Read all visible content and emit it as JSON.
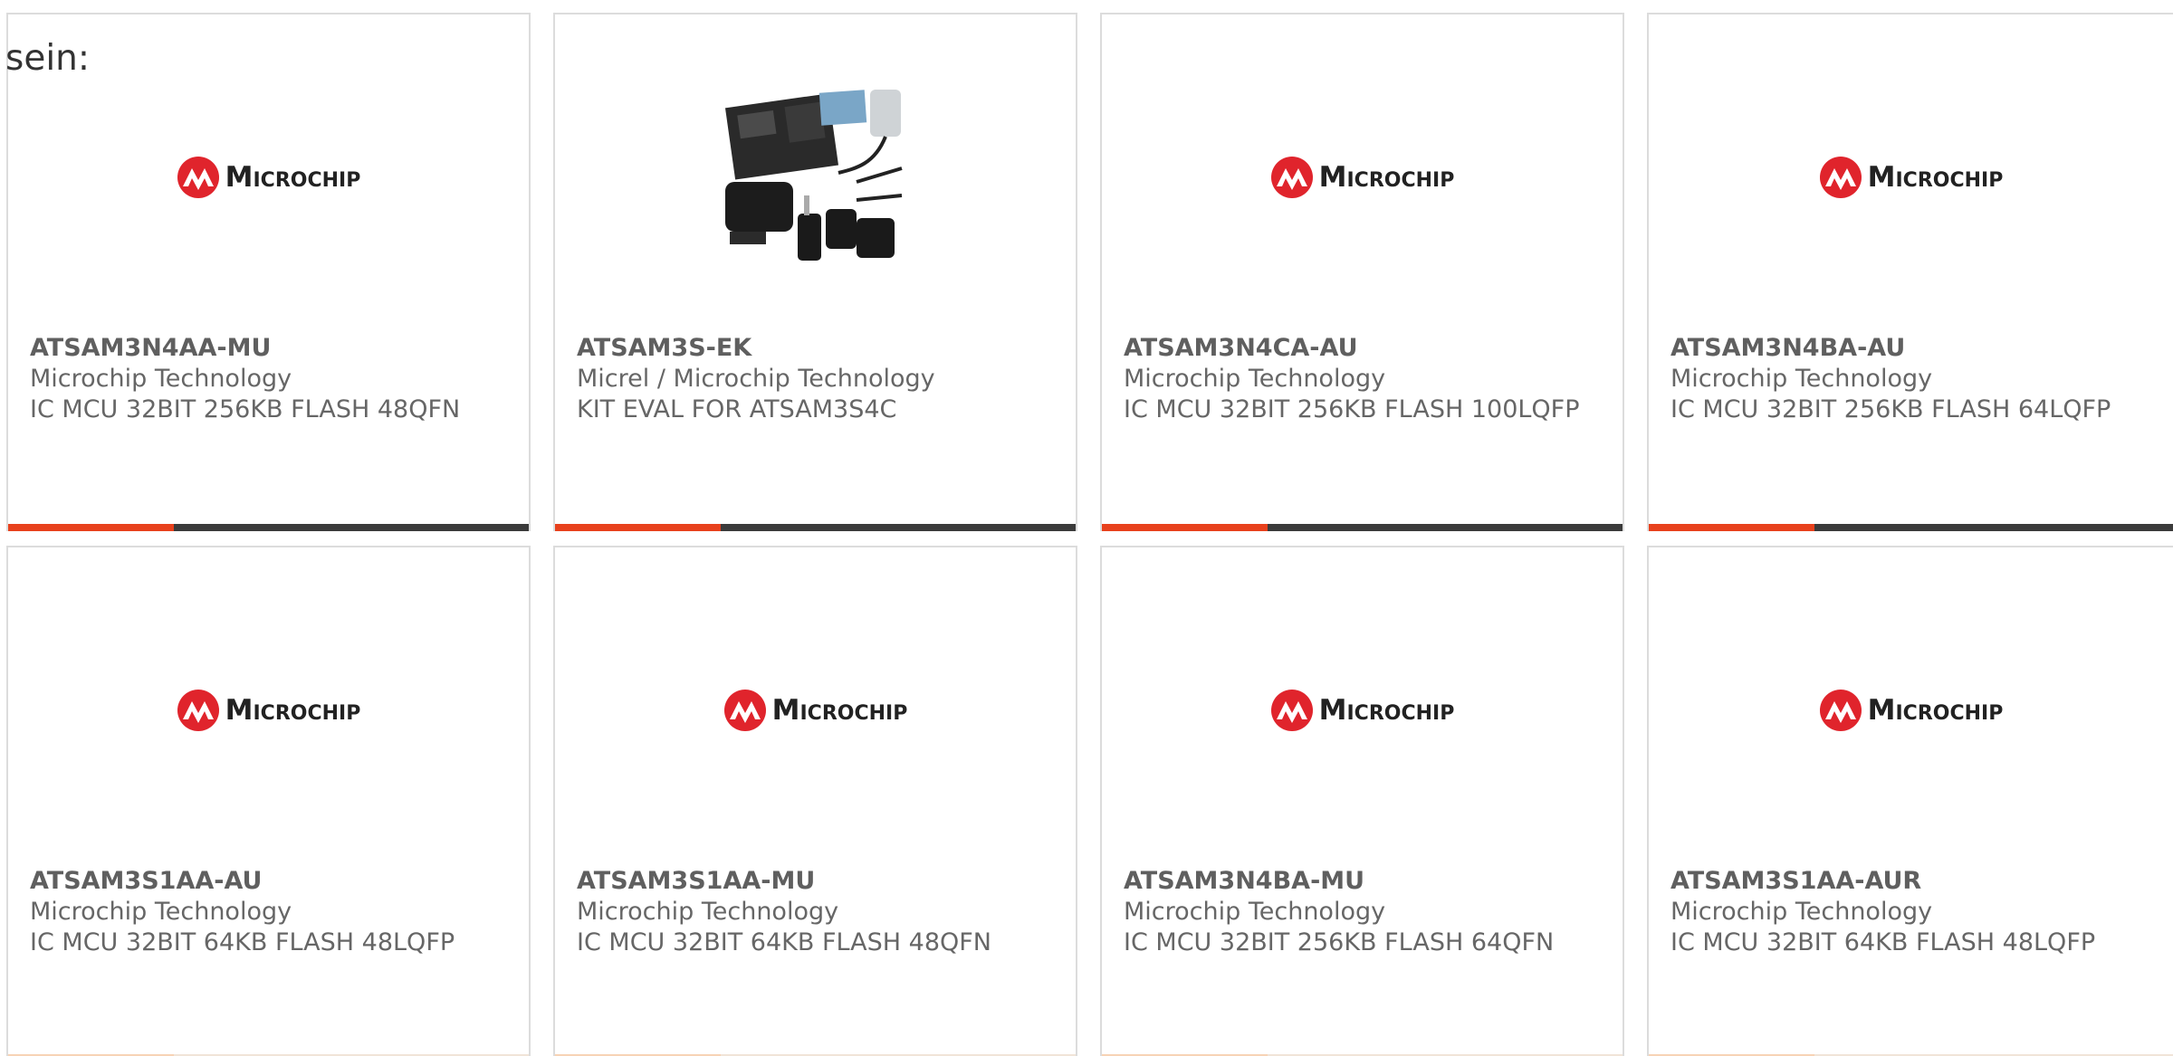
{
  "intro_text": "sein:",
  "colors": {
    "accent": "#e8411d",
    "bar_dark": "#3b3b3b",
    "logo_red": "#e0242c",
    "text": "#666666"
  },
  "logo_text": "Microchip",
  "products": [
    {
      "part": "ATSAM3N4AA-MU",
      "manufacturer": "Microchip Technology",
      "description": "IC MCU 32BIT 256KB FLASH 48QFN",
      "image": "microchip-logo"
    },
    {
      "part": "ATSAM3S-EK",
      "manufacturer": "Micrel / Microchip Technology",
      "description": "KIT EVAL FOR ATSAM3S4C",
      "image": "eval-kit-photo"
    },
    {
      "part": "ATSAM3N4CA-AU",
      "manufacturer": "Microchip Technology",
      "description": "IC MCU 32BIT 256KB FLASH 100LQFP",
      "image": "microchip-logo"
    },
    {
      "part": "ATSAM3N4BA-AU",
      "manufacturer": "Microchip Technology",
      "description": "IC MCU 32BIT 256KB FLASH 64LQFP",
      "image": "microchip-logo"
    },
    {
      "part": "ATSAM3S1AA-AU",
      "manufacturer": "Microchip Technology",
      "description": "IC MCU 32BIT 64KB FLASH 48LQFP",
      "image": "microchip-logo"
    },
    {
      "part": "ATSAM3S1AA-MU",
      "manufacturer": "Microchip Technology",
      "description": "IC MCU 32BIT 64KB FLASH 48QFN",
      "image": "microchip-logo"
    },
    {
      "part": "ATSAM3N4BA-MU",
      "manufacturer": "Microchip Technology",
      "description": "IC MCU 32BIT 256KB FLASH 64QFN",
      "image": "microchip-logo"
    },
    {
      "part": "ATSAM3S1AA-AUR",
      "manufacturer": "Microchip Technology",
      "description": "IC MCU 32BIT 64KB FLASH 48LQFP",
      "image": "microchip-logo"
    }
  ]
}
